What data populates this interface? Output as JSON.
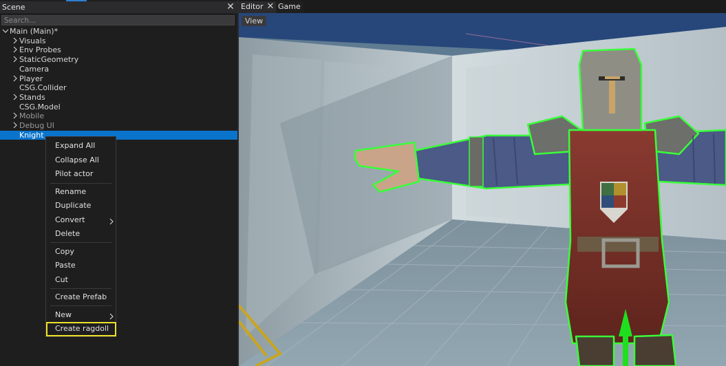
{
  "scene_panel": {
    "title": "Scene",
    "close_icon": "close-icon",
    "search_placeholder": "Search..."
  },
  "tree": {
    "root": {
      "label": "Main (Main)*",
      "expanded": true
    },
    "items": [
      {
        "label": "Visuals",
        "has_children": true,
        "dim": false,
        "selected": false
      },
      {
        "label": "Env Probes",
        "has_children": true,
        "dim": false,
        "selected": false
      },
      {
        "label": "StaticGeometry",
        "has_children": true,
        "dim": false,
        "selected": false
      },
      {
        "label": "Camera",
        "has_children": false,
        "dim": false,
        "selected": false
      },
      {
        "label": "Player",
        "has_children": true,
        "dim": false,
        "selected": false
      },
      {
        "label": "CSG.Collider",
        "has_children": false,
        "dim": false,
        "selected": false
      },
      {
        "label": "Stands",
        "has_children": true,
        "dim": false,
        "selected": false
      },
      {
        "label": "CSG.Model",
        "has_children": false,
        "dim": false,
        "selected": false
      },
      {
        "label": "Mobile",
        "has_children": true,
        "dim": true,
        "selected": false
      },
      {
        "label": "Debug UI",
        "has_children": true,
        "dim": true,
        "selected": false
      },
      {
        "label": "Knight",
        "has_children": false,
        "dim": false,
        "selected": true
      }
    ]
  },
  "context_menu": {
    "items": [
      {
        "label": "Expand All",
        "submenu": false
      },
      {
        "label": "Collapse All",
        "submenu": false
      },
      {
        "label": "Pilot actor",
        "submenu": false
      },
      {
        "label": "Rename",
        "submenu": false
      },
      {
        "label": "Duplicate",
        "submenu": false
      },
      {
        "label": "Convert",
        "submenu": true
      },
      {
        "label": "Delete",
        "submenu": false
      },
      {
        "label": "Copy",
        "submenu": false
      },
      {
        "label": "Paste",
        "submenu": false
      },
      {
        "label": "Cut",
        "submenu": false
      },
      {
        "label": "Create Prefab",
        "submenu": false
      },
      {
        "label": "New",
        "submenu": true
      },
      {
        "label": "Create ragdoll",
        "submenu": false,
        "highlighted": true
      }
    ]
  },
  "tabs": {
    "editor_label": "Editor",
    "game_label": "Game",
    "close_icon": "close-icon"
  },
  "viewport": {
    "view_button": "View"
  },
  "colors": {
    "selection": "#0a74cc",
    "highlight_outline": "#f0e02a",
    "gizmo_green": "#1fe01f",
    "actor_outline": "#39ff3a"
  }
}
